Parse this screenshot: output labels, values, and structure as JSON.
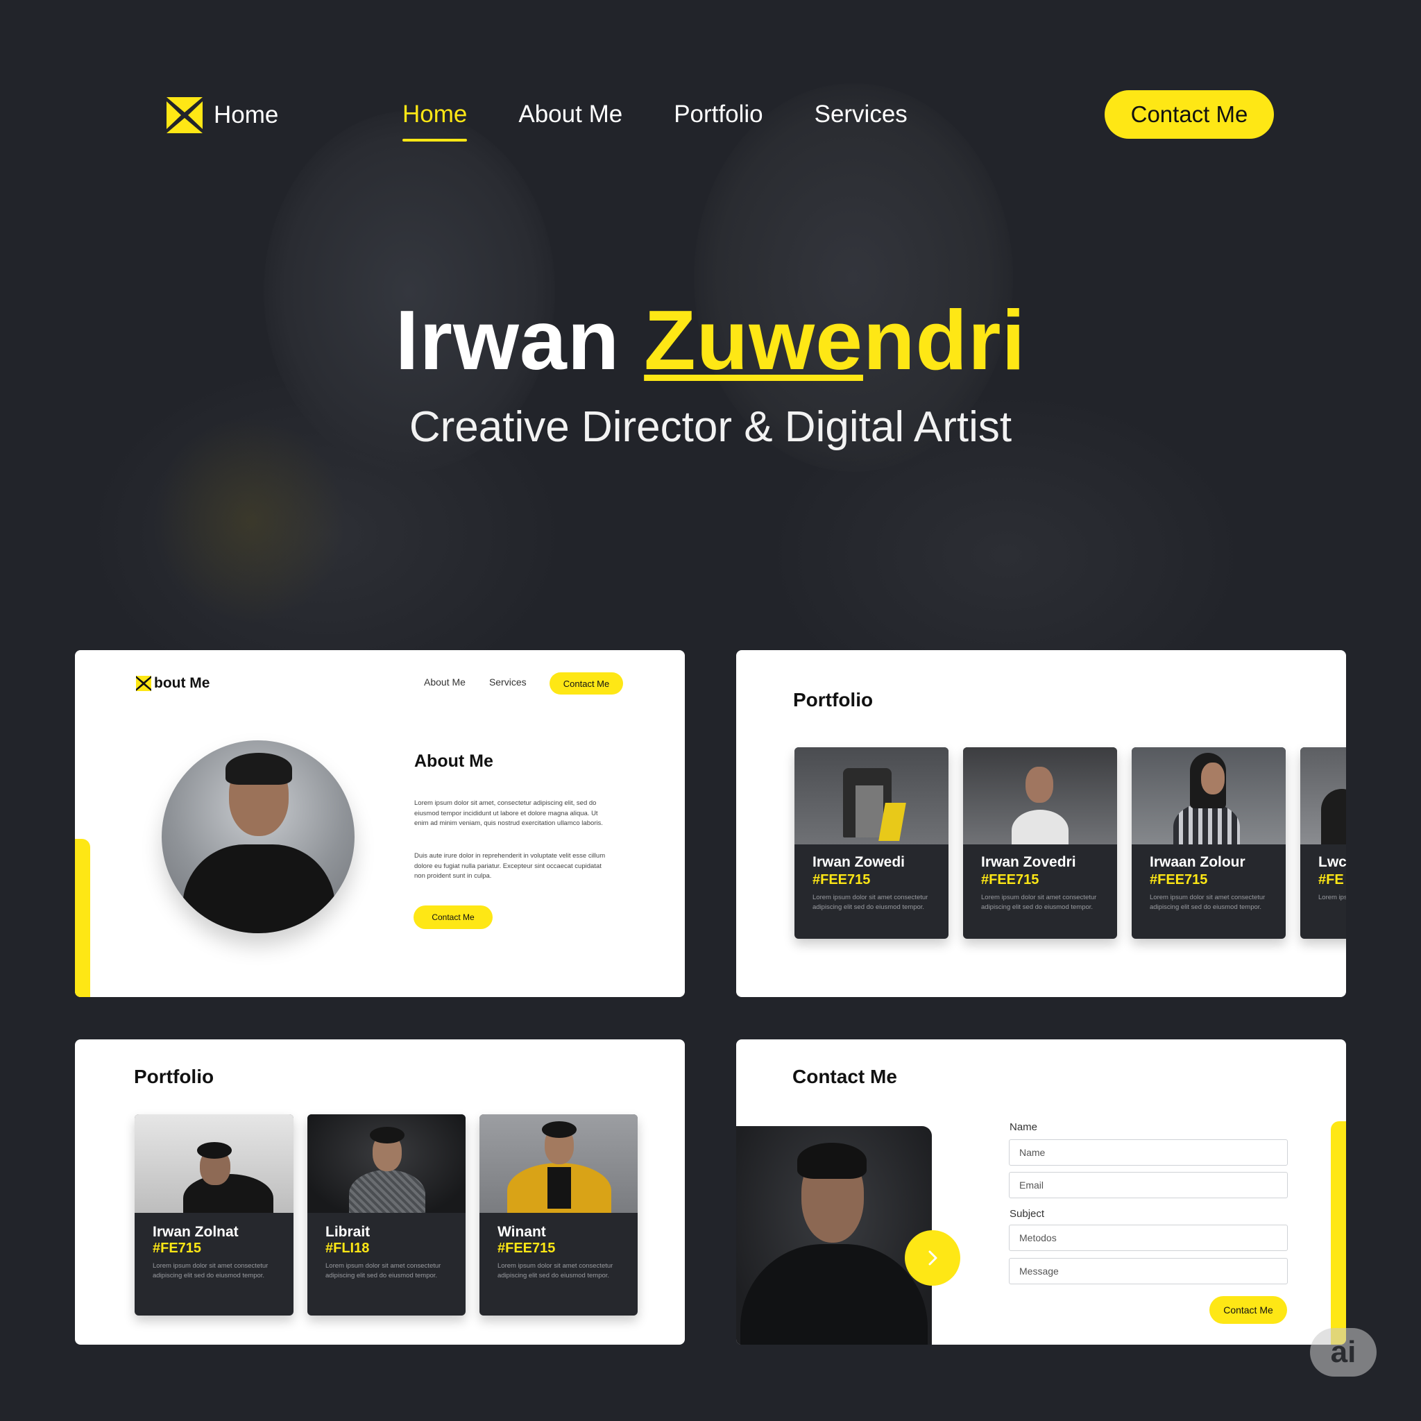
{
  "colors": {
    "accent": "#fee715",
    "background": "#22242a",
    "card": "#ffffff",
    "dark_card": "#26282d"
  },
  "nav": {
    "logo_icon": "x-logo-icon",
    "logo_text": "Home",
    "links": [
      {
        "label": "Home",
        "active": true
      },
      {
        "label": "About Me",
        "active": false
      },
      {
        "label": "Portfolio",
        "active": false
      },
      {
        "label": "Services",
        "active": false
      }
    ],
    "contact_label": "Contact Me"
  },
  "hero": {
    "first_name": "Irwan",
    "last_name_underlined": "Zuwe",
    "last_name_rest": "ndri",
    "subtitle": "Creative Director & Digital Artist"
  },
  "about_card": {
    "logo_text": "bout Me",
    "nav": [
      "About Me",
      "Services"
    ],
    "contact_label": "Contact Me",
    "title": "About Me",
    "paragraph1": "Lorem ipsum dolor sit amet, consectetur adipiscing elit, sed do eiusmod tempor incididunt ut labore et dolore magna aliqua. Ut enim ad minim veniam, quis nostrud exercitation ullamco laboris.",
    "paragraph2": "Duis aute irure dolor in reprehenderit in voluptate velit esse cillum dolore eu fugiat nulla pariatur. Excepteur sint occaecat cupidatat non proident sunt in culpa.",
    "button_label": "Contact Me"
  },
  "portfolio_card_top": {
    "title": "Portfolio",
    "items": [
      {
        "name": "Irwan Zowedi",
        "color": "#FEE715",
        "desc": "Lorem ipsum dolor sit amet consectetur adipiscing elit sed do eiusmod tempor."
      },
      {
        "name": "Irwan Zovedri",
        "color": "#FEE715",
        "desc": "Lorem ipsum dolor sit amet consectetur adipiscing elit sed do eiusmod tempor."
      },
      {
        "name": "Irwaan Zolour",
        "color": "#FEE715",
        "desc": "Lorem ipsum dolor sit amet consectetur adipiscing elit sed do eiusmod tempor."
      },
      {
        "name": "Lwc",
        "color": "#FE",
        "desc": "Lorem ipsum dolor sit amet."
      }
    ]
  },
  "portfolio_card_bottom": {
    "title": "Portfolio",
    "items": [
      {
        "name": "Irwan Zolnat",
        "color": "#FE715",
        "desc": "Lorem ipsum dolor sit amet consectetur adipiscing elit sed do eiusmod tempor."
      },
      {
        "name": "Librait",
        "color": "#FLI18",
        "desc": "Lorem ipsum dolor sit amet consectetur adipiscing elit sed do eiusmod tempor."
      },
      {
        "name": "Winant",
        "color": "#FEE715",
        "desc": "Lorem ipsum dolor sit amet consectetur adipiscing elit sed do eiusmod tempor."
      }
    ]
  },
  "contact_card": {
    "title": "Contact Me",
    "label_name": "Name",
    "name_placeholder": "Name",
    "email_placeholder": "Email",
    "label_subject": "Subject",
    "subject_placeholder": "Metodos",
    "message_placeholder": "Message",
    "send_label": "Contact Me"
  },
  "badge": "ai"
}
